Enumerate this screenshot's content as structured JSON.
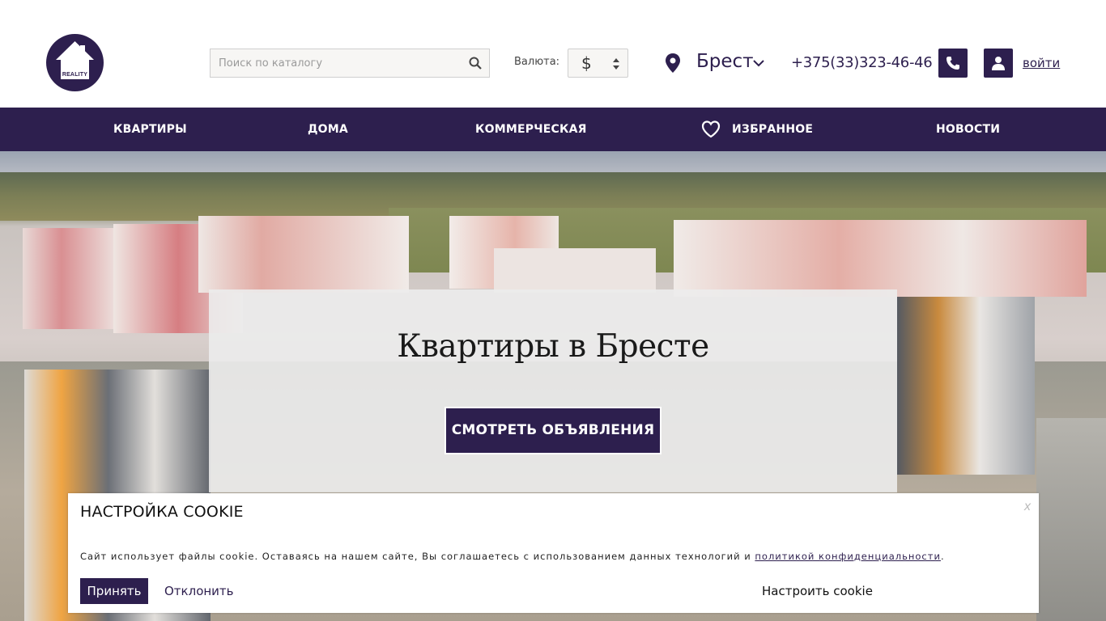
{
  "stray_char": ";",
  "logo": {
    "text": "REALITY",
    "icon": "house-icon"
  },
  "search": {
    "placeholder": "Поиск по каталогу",
    "value": "",
    "icon": "search-icon"
  },
  "currency": {
    "label": "Валюта:",
    "selected": "$"
  },
  "location": {
    "city": "Брест",
    "icon": "map-pin-icon"
  },
  "contact": {
    "phone": "+375(33)323-46-46"
  },
  "account": {
    "login_label": "войти"
  },
  "nav": {
    "items": [
      {
        "label": "КВАРТИРЫ"
      },
      {
        "label": "ДОМА"
      },
      {
        "label": "КОММЕРЧЕСКАЯ"
      },
      {
        "label": "ИЗБРАННОЕ"
      },
      {
        "label": "НОВОСТИ"
      }
    ]
  },
  "hero": {
    "title": "Квартиры в Бресте",
    "button_label": "СМОТРЕТЬ ОБЪЯВЛЕНИЯ"
  },
  "cookie": {
    "title": "НАСТРОЙКА COOKIE",
    "close_label": "x",
    "text_before": "Сайт использует файлы cookie. Оставаясь на нашем сайте, Вы соглашаетесь с использованием данных технологий и ",
    "link_text": "политикой конфиденциальности",
    "text_after": ".",
    "accept_label": "Принять",
    "decline_label": "Отклонить",
    "configure_label": "Настроить cookie"
  },
  "colors": {
    "brand": "#2d1f4e",
    "white": "#ffffff"
  }
}
